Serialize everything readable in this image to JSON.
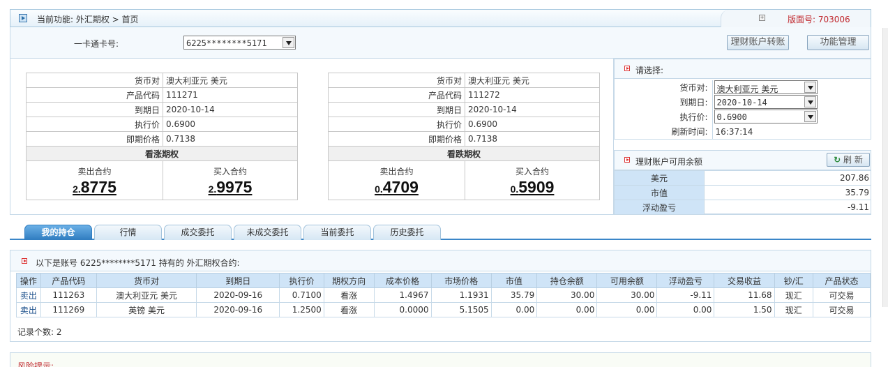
{
  "header": {
    "breadcrumb": "当前功能:  外汇期权 > 首页",
    "version_label": "版面号: 703006"
  },
  "card": {
    "label": "一卡通卡号:",
    "value": "6225********5171",
    "btn_transfer": "理财账户转账",
    "btn_manage": "功能管理"
  },
  "call": {
    "rows": [
      {
        "k": "货币对",
        "v": "澳大利亚元 美元"
      },
      {
        "k": "产品代码",
        "v": "111271"
      },
      {
        "k": "到期日",
        "v": "2020-10-14"
      },
      {
        "k": "执行价",
        "v": "0.6900"
      },
      {
        "k": "即期价格",
        "v": "0.7138"
      }
    ],
    "title": "看涨期权",
    "sell_label": "卖出合约",
    "sell_small": "2.",
    "sell_big": "8775",
    "buy_label": "买入合约",
    "buy_small": "2.",
    "buy_big": "9975"
  },
  "put": {
    "rows": [
      {
        "k": "货币对",
        "v": "澳大利亚元 美元"
      },
      {
        "k": "产品代码",
        "v": "111272"
      },
      {
        "k": "到期日",
        "v": "2020-10-14"
      },
      {
        "k": "执行价",
        "v": "0.6900"
      },
      {
        "k": "即期价格",
        "v": "0.7138"
      }
    ],
    "title": "看跌期权",
    "sell_label": "卖出合约",
    "sell_small": "0.",
    "sell_big": "4709",
    "buy_label": "买入合约",
    "buy_small": "0.",
    "buy_big": "5909"
  },
  "select": {
    "title": "请选择:",
    "pair_label": "货币对:",
    "pair_value": "澳大利亚元 美元",
    "date_label": "到期日:",
    "date_value": "2020-10-14",
    "strike_label": "执行价:",
    "strike_value": "0.6900",
    "refresh_label": "刷新时间:",
    "refresh_value": "16:37:14"
  },
  "balance": {
    "title": "理财账户可用余额",
    "refresh_btn": "刷 新",
    "rows": [
      {
        "k": "美元",
        "v": "207.86"
      },
      {
        "k": "市值",
        "v": "35.79"
      },
      {
        "k": "浮动盈亏",
        "v": "-9.11"
      }
    ]
  },
  "tabs": [
    "我的持仓",
    "行情",
    "成交委托",
    "未成交委托",
    "当前委托",
    "历史委托"
  ],
  "holdings": {
    "caption": "以下是账号 6225********5171 持有的 外汇期权合约:",
    "headers": [
      "操作",
      "产品代码",
      "货币对",
      "到期日",
      "执行价",
      "期权方向",
      "成本价格",
      "市场价格",
      "市值",
      "持仓余额",
      "可用余额",
      "浮动盈亏",
      "交易收益",
      "钞/汇",
      "产品状态"
    ],
    "rows": [
      [
        "卖出",
        "111263",
        "澳大利亚元 美元",
        "2020-09-16",
        "0.7100",
        "看涨",
        "1.4967",
        "1.1931",
        "35.79",
        "30.00",
        "30.00",
        "-9.11",
        "11.68",
        "现汇",
        "可交易"
      ],
      [
        "卖出",
        "111269",
        "英镑 美元",
        "2020-09-16",
        "1.2500",
        "看涨",
        "0.0000",
        "5.1505",
        "0.00",
        "0.00",
        "0.00",
        "0.00",
        "1.50",
        "现汇",
        "可交易"
      ]
    ],
    "count_label": "记录个数:  2"
  },
  "risk": {
    "label": "风险提示:"
  }
}
